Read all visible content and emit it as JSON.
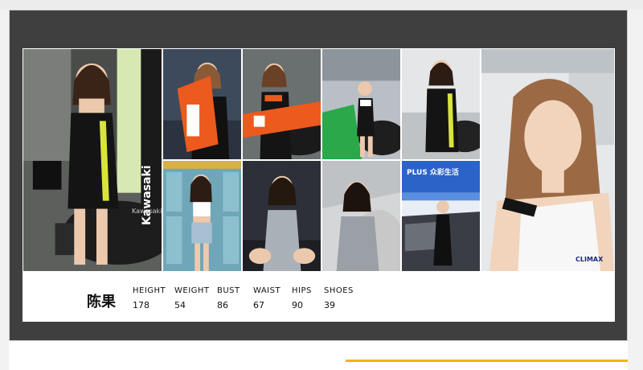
{
  "profile": {
    "name": "陈果",
    "stats": [
      {
        "label": "HEIGHT",
        "value": "178"
      },
      {
        "label": "WEIGHT",
        "value": "54"
      },
      {
        "label": "BUST",
        "value": "86"
      },
      {
        "label": "WAIST",
        "value": "67"
      },
      {
        "label": "HIPS",
        "value": "90"
      },
      {
        "label": "SHOES",
        "value": "39"
      }
    ]
  },
  "photo_text": {
    "kawasaki_banner": "Kawasaki",
    "kawasaki_bike": "Kawasaki",
    "plus_sign": "PLUS 众彩生活",
    "climax_logo": "CLIMAX"
  },
  "colors": {
    "frame": "#3f3f3f",
    "card": "#ffffff",
    "accent": "#f2b500",
    "sign_orange": "#ec5a1e",
    "outfit_black": "#141414",
    "outfit_yellow": "#d8e43a"
  }
}
